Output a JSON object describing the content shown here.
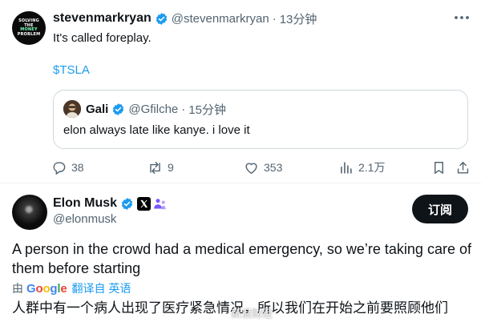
{
  "tweet1": {
    "avatar_text": [
      "SOLVING",
      "THE",
      "MONEY",
      "PROBLEM"
    ],
    "display_name": "stevenmarkryan",
    "handle": "@stevenmarkryan",
    "separator": "·",
    "time": "13分钟",
    "text": "It's called foreplay.",
    "cashtag": "$TSLA",
    "quote": {
      "display_name": "Gali",
      "handle": "@Gfilche",
      "separator": "·",
      "time": "15分钟",
      "text": "elon always late like kanye. i love it"
    },
    "actions": {
      "replies": "38",
      "reposts": "9",
      "likes": "353",
      "views": "2.1万"
    }
  },
  "tweet2": {
    "display_name": "Elon Musk",
    "handle": "@elonmusk",
    "subscribe_label": "订阅",
    "text": "A person in the crowd had a medical emergency, so we’re taking care of them before starting",
    "translate_prefix": "由",
    "translate_provider": "Google",
    "translate_suffix": "翻译自 英语",
    "translated_text": "人群中有一个病人出现了医疗紧急情况，所以我们在开始之前要照顾他们"
  },
  "watermark": "新浪财经",
  "colors": {
    "accent": "#1d9bf0",
    "text": "#0f1419",
    "muted": "#536471",
    "border": "#cfd9de",
    "verified": "#1d9bf0",
    "affiliate": "#7856ff"
  },
  "icons": {
    "verified": "verified-badge-icon",
    "more": "more-horizontal-icon",
    "reply": "reply-icon",
    "repost": "repost-icon",
    "like": "heart-icon",
    "views": "views-icon",
    "bookmark": "bookmark-icon",
    "share": "share-icon",
    "x_badge": "x-logo-icon",
    "affiliate": "affiliate-people-icon"
  }
}
